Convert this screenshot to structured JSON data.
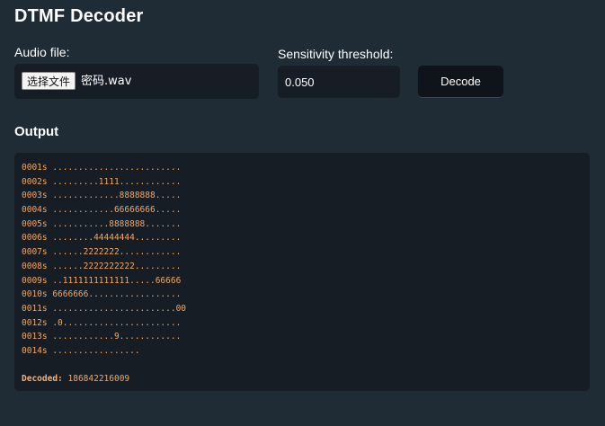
{
  "app": {
    "title": "DTMF Decoder"
  },
  "audio": {
    "label": "Audio file:",
    "button_label": "选择文件",
    "file_name": "密码.wav"
  },
  "sensitivity": {
    "label": "Sensitivity threshold:",
    "value": "0.050"
  },
  "decode_button": {
    "label": "Decode"
  },
  "output": {
    "heading": "Output",
    "lines": [
      "0001s .........................",
      "0002s .........1111............",
      "0003s .............8888888.....",
      "0004s ............66666666.....",
      "0005s ...........8888888.......",
      "0006s ........44444444.........",
      "0007s ......2222222............",
      "0008s ......2222222222.........",
      "0009s ..1111111111111.....66666",
      "0010s 6666666..................",
      "0011s ........................00",
      "0012s .0.......................",
      "0013s ............9............",
      "0014s ................."
    ],
    "decoded_label": "Decoded:",
    "decoded_value": "186842216009"
  },
  "colors": {
    "background": "#1f2b35",
    "panel": "#161d24",
    "output_text": "#f0a868"
  }
}
